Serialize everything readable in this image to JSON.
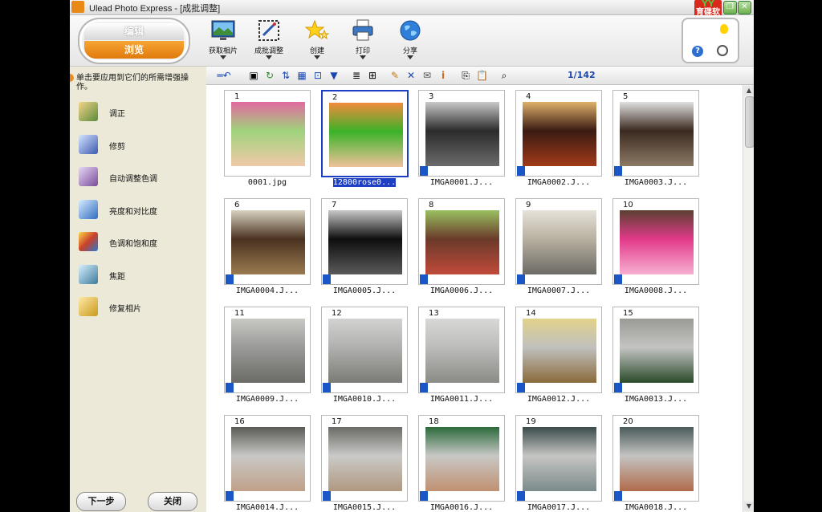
{
  "window": {
    "title": "Ulead Photo Express - [成批调整]",
    "brand_top": "YY",
    "brand_text": "育碟软件"
  },
  "mode_switch": {
    "edit_label": "编辑",
    "browse_label": "浏览"
  },
  "toolbar": {
    "buttons": [
      {
        "label": "获取相片",
        "icon": "monitor-icon"
      },
      {
        "label": "成批调整",
        "icon": "batch-adjust-icon"
      },
      {
        "label": "创建",
        "icon": "star-icon"
      },
      {
        "label": "打印",
        "icon": "printer-icon"
      },
      {
        "label": "分享",
        "icon": "globe-icon"
      }
    ]
  },
  "help_box": {
    "help_glyph": "?"
  },
  "left_panel": {
    "hint": "单击要应用到它们的所需增强操作。",
    "tools": [
      {
        "label": "调正",
        "color": "#5a8a3a"
      },
      {
        "label": "修剪",
        "color": "#3a5ab0"
      },
      {
        "label": "自动调整色调",
        "color": "#7a4a9a"
      },
      {
        "label": "亮度和对比度",
        "color": "#2f6cc0"
      },
      {
        "label": "色调和饱和度",
        "color": "#c8402a"
      },
      {
        "label": "焦距",
        "color": "#3a7a9a"
      },
      {
        "label": "修复相片",
        "color": "#c99a1a"
      }
    ],
    "next_button": "下一步",
    "close_button": "关闭"
  },
  "browser": {
    "counter": "1/142",
    "thumbnails": [
      {
        "num": "1",
        "name": "0001.jpg",
        "exif": false,
        "palette": [
          "#9fd37c",
          "#f1c9a8",
          "#e26aa0"
        ]
      },
      {
        "num": "2",
        "name": "12800rose0...",
        "exif": false,
        "selected": true,
        "palette": [
          "#3bb22a",
          "#f0c29a",
          "#f28a3a"
        ]
      },
      {
        "num": "3",
        "name": "IMGA0001.J...",
        "exif": true,
        "palette": [
          "#2b2b2b",
          "#6b6b6b",
          "#c9c9c9"
        ]
      },
      {
        "num": "4",
        "name": "IMGA0002.J...",
        "exif": true,
        "palette": [
          "#3a1b12",
          "#a23a1a",
          "#e0b06a"
        ]
      },
      {
        "num": "5",
        "name": "IMGA0003.J...",
        "exif": true,
        "palette": [
          "#3b2a20",
          "#8c7a66",
          "#e0e0e0"
        ]
      },
      {
        "num": "6",
        "name": "IMGA0004.J...",
        "exif": true,
        "palette": [
          "#4a3220",
          "#9a7a50",
          "#d8d2c0"
        ]
      },
      {
        "num": "7",
        "name": "IMGA0005.J...",
        "exif": true,
        "palette": [
          "#0e0e0e",
          "#5a5a5a",
          "#c8c8c8"
        ]
      },
      {
        "num": "8",
        "name": "IMGA0006.J...",
        "exif": true,
        "palette": [
          "#6a3a2a",
          "#c04a3a",
          "#9ac060"
        ]
      },
      {
        "num": "9",
        "name": "IMGA0007.J...",
        "exif": true,
        "palette": [
          "#b8b0a0",
          "#6c6a66",
          "#e6e2da"
        ]
      },
      {
        "num": "10",
        "name": "IMGA0008.J...",
        "exif": true,
        "palette": [
          "#e23a8a",
          "#f7b0d0",
          "#5a4030"
        ]
      },
      {
        "num": "11",
        "name": "IMGA0009.J...",
        "exif": true,
        "palette": [
          "#9a9a98",
          "#6a6a66",
          "#c8c8c4"
        ]
      },
      {
        "num": "12",
        "name": "IMGA0010.J...",
        "exif": true,
        "palette": [
          "#b0b0ae",
          "#7a7a76",
          "#d2d2d0"
        ]
      },
      {
        "num": "13",
        "name": "IMGA0011.J...",
        "exif": true,
        "palette": [
          "#bcbcba",
          "#8a8a86",
          "#d8d8d6"
        ]
      },
      {
        "num": "14",
        "name": "IMGA0012.J...",
        "exif": true,
        "palette": [
          "#c0c0be",
          "#8a6a3a",
          "#e2d28a"
        ]
      },
      {
        "num": "15",
        "name": "IMGA0013.J...",
        "exif": true,
        "palette": [
          "#c4c4c2",
          "#2a4a2a",
          "#9a9a96"
        ]
      },
      {
        "num": "16",
        "name": "IMGA0014.J...",
        "exif": true,
        "palette": [
          "#c8c8c6",
          "#c0a088",
          "#5a5a56"
        ]
      },
      {
        "num": "17",
        "name": "IMGA0015.J...",
        "exif": true,
        "palette": [
          "#cacac8",
          "#b09880",
          "#6a6a66"
        ]
      },
      {
        "num": "18",
        "name": "IMGA0016.J...",
        "exif": true,
        "palette": [
          "#c8c8c6",
          "#c09070",
          "#2a6a3a"
        ]
      },
      {
        "num": "19",
        "name": "IMGA0017.J...",
        "exif": true,
        "palette": [
          "#c6c6c4",
          "#7a8a8a",
          "#3a4a4a"
        ]
      },
      {
        "num": "20",
        "name": "IMGA0018.J...",
        "exif": true,
        "palette": [
          "#c4c4c2",
          "#b06a4a",
          "#4a5a5a"
        ]
      }
    ]
  }
}
